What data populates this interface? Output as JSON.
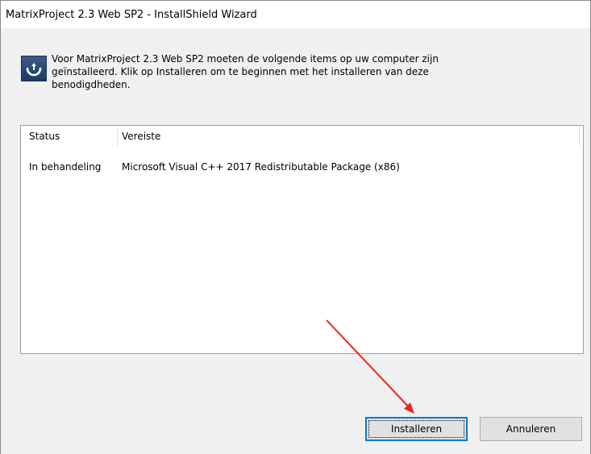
{
  "window": {
    "title": "MatrixProject 2.3 Web SP2 - InstallShield Wizard"
  },
  "intro": {
    "line1": "Voor MatrixProject 2.3 Web SP2 moeten de volgende items op uw computer zijn",
    "line2": "geïnstalleerd. Klik op Installeren om te beginnen met het installeren van deze",
    "line3": "benodigdheden."
  },
  "list": {
    "columns": [
      "Status",
      "Vereiste"
    ],
    "rows": [
      {
        "status": "In behandeling",
        "requirement": "Microsoft Visual C++ 2017 Redistributable Package (x86)"
      }
    ]
  },
  "buttons": {
    "install": "Installeren",
    "cancel": "Annuleren"
  },
  "icons": {
    "app": "installshield-app-icon",
    "annotation": "red-arrow-annotation"
  },
  "colors": {
    "focus_border": "#0078d7",
    "annotation_arrow": "#e8261e"
  }
}
